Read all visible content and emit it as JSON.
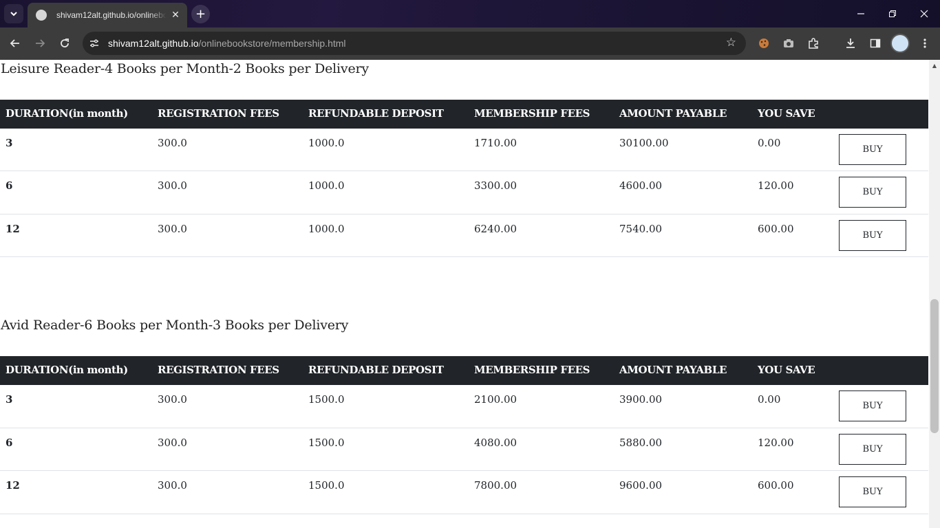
{
  "browser": {
    "tab_title": "shivam12alt.github.io/onlinebookstore/membership.html",
    "tab_close": "✕",
    "new_tab": "+",
    "url_host": "shivam12alt.github.io",
    "url_path": "/onlinebookstore/membership.html"
  },
  "columns": [
    "DURATION(in month)",
    "REGISTRATION FEES",
    "REFUNDABLE DEPOSIT",
    "MEMBERSHIP FEES",
    "AMOUNT PAYABLE",
    "YOU SAVE"
  ],
  "plans": [
    {
      "title": "Leisure Reader-4 Books per Month-2 Books per Delivery",
      "rows": [
        {
          "duration": "3",
          "registration": "300.0",
          "deposit": "1000.0",
          "membership": "1710.00",
          "payable": "30100.00",
          "save": "0.00",
          "button": "BUY"
        },
        {
          "duration": "6",
          "registration": "300.0",
          "deposit": "1000.0",
          "membership": "3300.00",
          "payable": "4600.00",
          "save": "120.00",
          "button": "BUY"
        },
        {
          "duration": "12",
          "registration": "300.0",
          "deposit": "1000.0",
          "membership": "6240.00",
          "payable": "7540.00",
          "save": "600.00",
          "button": "BUY"
        }
      ]
    },
    {
      "title": "Avid Reader-6 Books per Month-3 Books per Delivery",
      "rows": [
        {
          "duration": "3",
          "registration": "300.0",
          "deposit": "1500.0",
          "membership": "2100.00",
          "payable": "3900.00",
          "save": "0.00",
          "button": "BUY"
        },
        {
          "duration": "6",
          "registration": "300.0",
          "deposit": "1500.0",
          "membership": "4080.00",
          "payable": "5880.00",
          "save": "120.00",
          "button": "BUY"
        },
        {
          "duration": "12",
          "registration": "300.0",
          "deposit": "1500.0",
          "membership": "7800.00",
          "payable": "9600.00",
          "save": "600.00",
          "button": "BUY"
        }
      ]
    }
  ]
}
